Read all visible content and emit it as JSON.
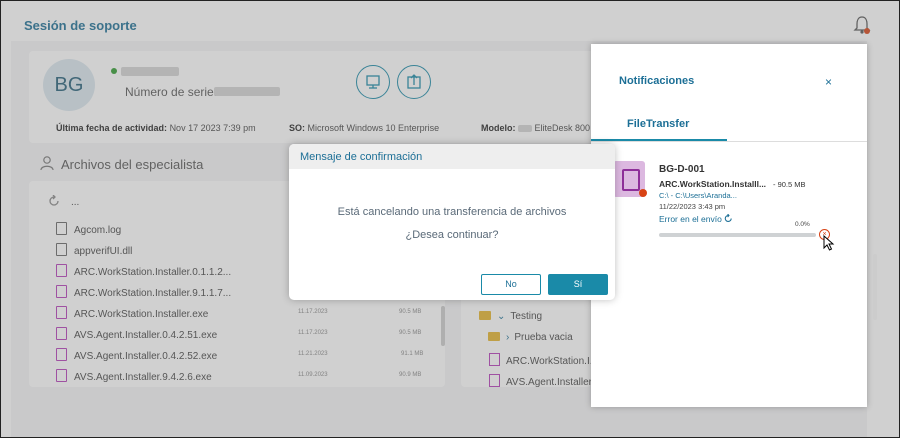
{
  "header": {
    "title": "Sesión de soporte"
  },
  "device": {
    "avatar_initials": "BG",
    "serial_label": "Número de serie:",
    "last_activity_label": "Última fecha de actividad:",
    "last_activity_value": "Nov 17 2023 7:39 pm",
    "os_label": "SO:",
    "os_value": "Microsoft Windows 10 Enterprise",
    "model_label": "Modelo:",
    "model_value": "EliteDesk 800"
  },
  "specialist_files": {
    "title": "Archivos del especialista",
    "parent_dir": "...",
    "files": [
      {
        "name": "Agcom.log",
        "date": "",
        "size": ""
      },
      {
        "name": "appverifUI.dll",
        "date": "",
        "size": ""
      },
      {
        "name": "ARC.WorkStation.Installer.0.1.1.2...",
        "date": "",
        "size": ""
      },
      {
        "name": "ARC.WorkStation.Installer.9.1.1.7...",
        "date": "",
        "size": ""
      },
      {
        "name": "ARC.WorkStation.Installer.exe",
        "date": "11.17.2023",
        "size": "90.5 MB"
      },
      {
        "name": "AVS.Agent.Installer.0.4.2.51.exe",
        "date": "11.17.2023",
        "size": "90.5 MB"
      },
      {
        "name": "AVS.Agent.Installer.0.4.2.52.exe",
        "date": "11.21.2023",
        "size": "91.1 MB"
      },
      {
        "name": "AVS.Agent.Installer.9.4.2.6.exe",
        "date": "11.09.2023",
        "size": "90.9 MB"
      }
    ]
  },
  "remote_tree": {
    "items": [
      {
        "name": "Testing"
      },
      {
        "name": "Prueba vacia"
      },
      {
        "name": "ARC.WorkStation.I..."
      },
      {
        "name": "AVS.Agent.Installer..."
      }
    ]
  },
  "notifications": {
    "title": "Notificaciones",
    "close_glyph": "×",
    "tab": "FileTransfer",
    "item": {
      "device": "BG-D-001",
      "file": "ARC.WorkStation.Installl...",
      "size": "- 90.5 MB",
      "path": "C:\\ - C:\\Users\\Aranda...",
      "date": "11/22/2023 3:43 pm",
      "status": "Error en el envío",
      "progress_text": "0.0%",
      "progress": 0
    }
  },
  "modal": {
    "title": "Mensaje de confirmación",
    "message": "Está cancelando una transferencia de archivos",
    "question": "¿Desea continuar?",
    "no_label": "No",
    "yes_label": "Sí"
  },
  "colors": {
    "accent": "#1a8aa8",
    "title": "#1c6f96",
    "error": "#d84315",
    "exe_icon": "#b43cb8"
  }
}
